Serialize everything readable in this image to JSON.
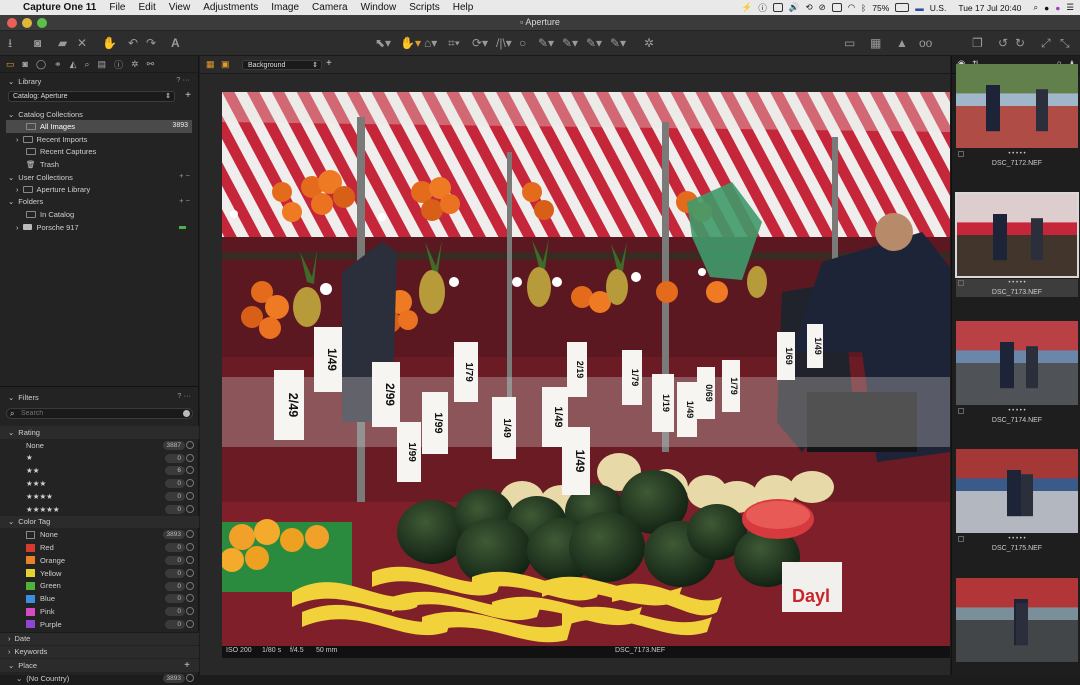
{
  "menubar": {
    "app": "Capture One 11",
    "items": [
      "File",
      "Edit",
      "View",
      "Adjustments",
      "Image",
      "Camera",
      "Window",
      "Scripts",
      "Help"
    ],
    "battery": "75%",
    "input_source": "U.S.",
    "clock": "Tue 17 Jul  20:40"
  },
  "window": {
    "title": "Aperture"
  },
  "viewer": {
    "style_select": "Background",
    "add": "+"
  },
  "library": {
    "title": "Library",
    "catalog_select": "Catalog: Aperture",
    "catalog_collections_label": "Catalog Collections",
    "catalog_collections": [
      {
        "label": "All Images",
        "count": "3893"
      },
      {
        "label": "Recent Imports",
        "count": ""
      },
      {
        "label": "Recent Captures",
        "count": ""
      },
      {
        "label": "Trash",
        "count": ""
      }
    ],
    "user_collections_label": "User Collections",
    "user_collections": [
      {
        "label": "Aperture Library"
      }
    ],
    "folders_label": "Folders",
    "folders": [
      {
        "label": "In Catalog"
      },
      {
        "label": "Porsche 917"
      }
    ]
  },
  "filters": {
    "title": "Filters",
    "search_placeholder": "Search",
    "rating_label": "Rating",
    "ratings": [
      {
        "label": "None",
        "count": "3887"
      },
      {
        "label": "★",
        "count": "0"
      },
      {
        "label": "★★",
        "count": "6"
      },
      {
        "label": "★★★",
        "count": "0"
      },
      {
        "label": "★★★★",
        "count": "0"
      },
      {
        "label": "★★★★★",
        "count": "0"
      }
    ],
    "color_tag_label": "Color Tag",
    "color_tags": [
      {
        "label": "None",
        "count": "3893",
        "color": ""
      },
      {
        "label": "Red",
        "count": "0",
        "color": "#d63b2e"
      },
      {
        "label": "Orange",
        "count": "0",
        "color": "#e8832a"
      },
      {
        "label": "Yellow",
        "count": "0",
        "color": "#e5d22f"
      },
      {
        "label": "Green",
        "count": "0",
        "color": "#4fb338"
      },
      {
        "label": "Blue",
        "count": "0",
        "color": "#3a8fe0"
      },
      {
        "label": "Pink",
        "count": "0",
        "color": "#d54bc4"
      },
      {
        "label": "Purple",
        "count": "0",
        "color": "#8e47d0"
      }
    ],
    "date_label": "Date",
    "keywords_label": "Keywords",
    "place_label": "Place",
    "no_country": "(No Country)",
    "no_country_count": "3893"
  },
  "image_info": {
    "iso": "ISO 200",
    "shutter": "1/80 s",
    "aperture": "f/4.5",
    "focal": "50 mm",
    "filename": "DSC_7173.NEF"
  },
  "filmstrip": [
    {
      "name": "DSC_7172.NEF",
      "rating": "• • • • •",
      "selected": false
    },
    {
      "name": "DSC_7173.NEF",
      "rating": "• • • • •",
      "selected": true
    },
    {
      "name": "DSC_7174.NEF",
      "rating": "• • • • •",
      "selected": false
    },
    {
      "name": "DSC_7175.NEF",
      "rating": "• • • • •",
      "selected": false
    },
    {
      "name": "",
      "rating": "",
      "selected": false
    }
  ],
  "price_signs": [
    "2/49",
    "1/49",
    "2/99",
    "1/99",
    "1/79",
    "1/49",
    "1/49",
    "2/19",
    "1/79",
    "1/19",
    "1/49",
    "0/69",
    "1/79",
    "1/49",
    "1/99",
    "1/69",
    "1/49"
  ],
  "box_text": "Dayl"
}
